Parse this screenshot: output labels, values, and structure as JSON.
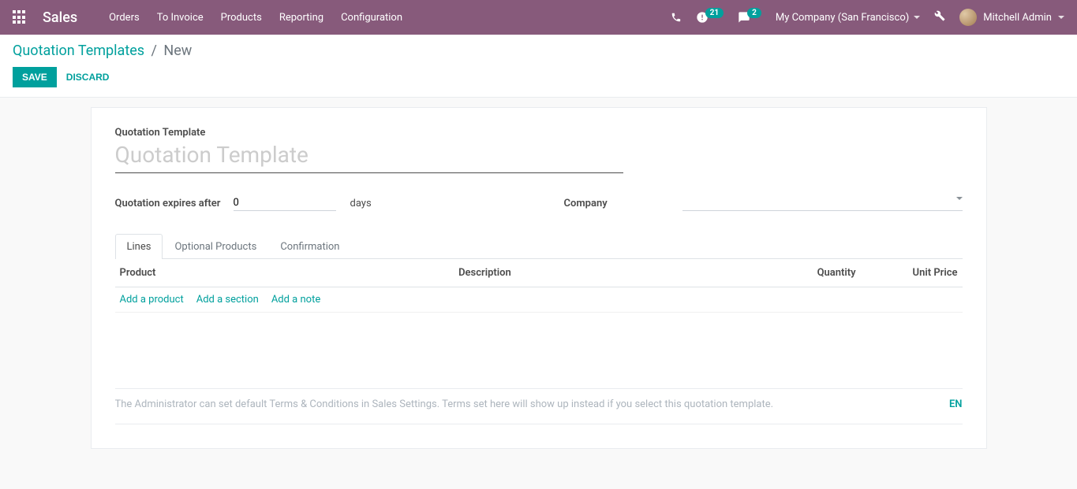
{
  "navbar": {
    "brand": "Sales",
    "menu": [
      "Orders",
      "To Invoice",
      "Products",
      "Reporting",
      "Configuration"
    ],
    "activity_badge": "21",
    "message_badge": "2",
    "company": "My Company (San Francisco)",
    "user": "Mitchell Admin"
  },
  "breadcrumb": {
    "parent": "Quotation Templates",
    "current": "New"
  },
  "actions": {
    "save": "SAVE",
    "discard": "DISCARD"
  },
  "form": {
    "title_label": "Quotation Template",
    "title_placeholder": "Quotation Template",
    "title_value": "",
    "expires_label": "Quotation expires after",
    "expires_value": "0",
    "expires_suffix": "days",
    "company_label": "Company",
    "company_value": ""
  },
  "tabs": [
    "Lines",
    "Optional Products",
    "Confirmation"
  ],
  "active_tab": 0,
  "table": {
    "headers": {
      "product": "Product",
      "description": "Description",
      "quantity": "Quantity",
      "unit_price": "Unit Price"
    },
    "add_links": {
      "product": "Add a product",
      "section": "Add a section",
      "note": "Add a note"
    }
  },
  "terms": {
    "placeholder": "The Administrator can set default Terms & Conditions in Sales Settings. Terms set here will show up instead if you select this quotation template.",
    "lang": "EN"
  }
}
